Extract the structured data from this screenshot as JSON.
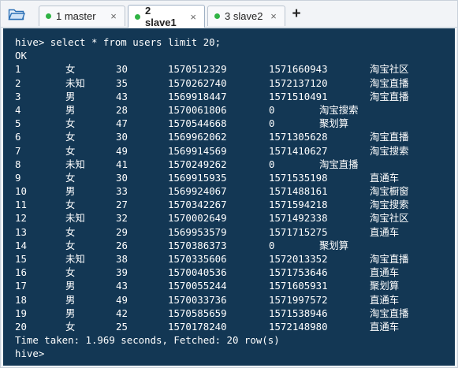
{
  "tabs": [
    {
      "label": "1 master",
      "close": "×",
      "status_color": "#2fb344"
    },
    {
      "label": "2 slave1",
      "close": "×",
      "status_color": "#2fb344"
    },
    {
      "label": "3 slave2",
      "close": "×",
      "status_color": "#2fb344"
    }
  ],
  "active_tab": "2 slave1",
  "new_tab_label": "+",
  "terminal": {
    "command": "hive> select * from users limit 20;",
    "ok": "OK",
    "rows": [
      {
        "id": "1",
        "gender": "女",
        "age": "30",
        "t1": "1570512329",
        "t2": "1571660943",
        "source": "淘宝社区"
      },
      {
        "id": "2",
        "gender": "未知",
        "age": "35",
        "t1": "1570262740",
        "t2": "1572137120",
        "source": "淘宝直播"
      },
      {
        "id": "3",
        "gender": "男",
        "age": "43",
        "t1": "1569918447",
        "t2": "1571510491",
        "source": "淘宝直播"
      },
      {
        "id": "4",
        "gender": "男",
        "age": "28",
        "t1": "1570061806",
        "t2": "0",
        "source": "淘宝搜索"
      },
      {
        "id": "5",
        "gender": "女",
        "age": "47",
        "t1": "1570544668",
        "t2": "0",
        "source": "聚划算"
      },
      {
        "id": "6",
        "gender": "女",
        "age": "30",
        "t1": "1569962062",
        "t2": "1571305628",
        "source": "淘宝直播"
      },
      {
        "id": "7",
        "gender": "女",
        "age": "49",
        "t1": "1569914569",
        "t2": "1571410627",
        "source": "淘宝搜索"
      },
      {
        "id": "8",
        "gender": "未知",
        "age": "41",
        "t1": "1570249262",
        "t2": "0",
        "source": "淘宝直播"
      },
      {
        "id": "9",
        "gender": "女",
        "age": "30",
        "t1": "1569915935",
        "t2": "1571535198",
        "source": "直通车"
      },
      {
        "id": "10",
        "gender": "男",
        "age": "33",
        "t1": "1569924067",
        "t2": "1571488161",
        "source": "淘宝橱窗"
      },
      {
        "id": "11",
        "gender": "女",
        "age": "27",
        "t1": "1570342267",
        "t2": "1571594218",
        "source": "淘宝搜索"
      },
      {
        "id": "12",
        "gender": "未知",
        "age": "32",
        "t1": "1570002649",
        "t2": "1571492338",
        "source": "淘宝社区"
      },
      {
        "id": "13",
        "gender": "女",
        "age": "29",
        "t1": "1569953579",
        "t2": "1571715275",
        "source": "直通车"
      },
      {
        "id": "14",
        "gender": "女",
        "age": "26",
        "t1": "1570386373",
        "t2": "0",
        "source": "聚划算"
      },
      {
        "id": "15",
        "gender": "未知",
        "age": "38",
        "t1": "1570335606",
        "t2": "1572013352",
        "source": "淘宝直播"
      },
      {
        "id": "16",
        "gender": "女",
        "age": "39",
        "t1": "1570040536",
        "t2": "1571753646",
        "source": "直通车"
      },
      {
        "id": "17",
        "gender": "男",
        "age": "43",
        "t1": "1570055244",
        "t2": "1571605931",
        "source": "聚划算"
      },
      {
        "id": "18",
        "gender": "男",
        "age": "49",
        "t1": "1570033736",
        "t2": "1571997572",
        "source": "直通车"
      },
      {
        "id": "19",
        "gender": "男",
        "age": "42",
        "t1": "1570585659",
        "t2": "1571538946",
        "source": "淘宝直播"
      },
      {
        "id": "20",
        "gender": "女",
        "age": "25",
        "t1": "1570178240",
        "t2": "1572148980",
        "source": "直通车"
      }
    ],
    "summary": "Time taken: 1.969 seconds, Fetched: 20 row(s)",
    "prompt": "hive>",
    "background_color": "#133754",
    "text_color": "#ffffff"
  }
}
